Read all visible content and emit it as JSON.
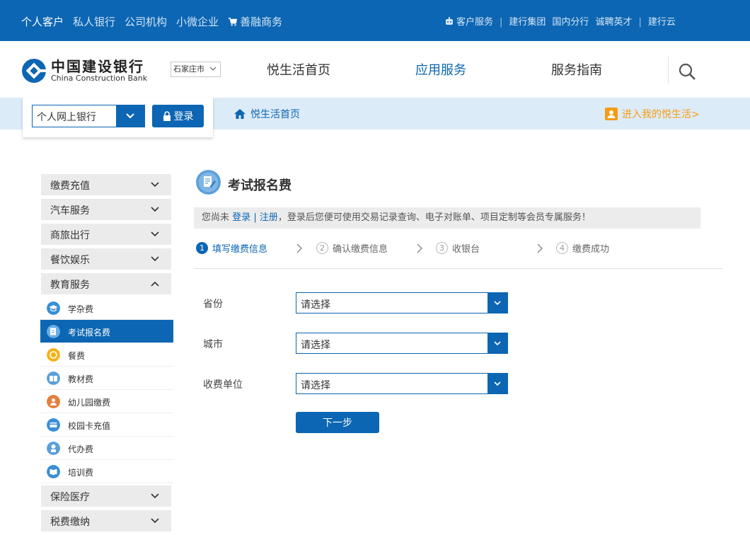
{
  "colors": {
    "brand": "#0c66b3",
    "accent_orange": "#f39c12",
    "subbar": "#dcebf8"
  },
  "topnav": {
    "items": [
      {
        "label": "个人客户",
        "active": true
      },
      {
        "label": "私人银行"
      },
      {
        "label": "公司机构"
      },
      {
        "label": "小微企业"
      },
      {
        "label": "善融商务",
        "icon": "cart-icon"
      }
    ],
    "right": {
      "customer_service": "客户服务",
      "group": "建行集团",
      "domestic": "国内分行",
      "careers": "诚聘英才",
      "cloud": "建行云"
    }
  },
  "header": {
    "logo_cn": "中国建设银行",
    "logo_en": "China Construction Bank",
    "city": "石家庄市",
    "nav": [
      {
        "label": "悦生活首页"
      },
      {
        "label": "应用服务",
        "active": true
      },
      {
        "label": "服务指南"
      }
    ],
    "search_icon": "search-icon"
  },
  "login": {
    "bank_type": "个人网上银行",
    "login_label": "登录"
  },
  "breadcrumb": {
    "home_label": "悦生活首页"
  },
  "mylife_link": "进入我的悦生活>",
  "sidebar": {
    "categories_top": [
      {
        "label": "缴费充值"
      },
      {
        "label": "汽车服务"
      },
      {
        "label": "商旅出行"
      },
      {
        "label": "餐饮娱乐"
      }
    ],
    "expanded": {
      "label": "教育服务",
      "items": [
        {
          "label": "学杂费",
          "icon": "graduation-cap-icon",
          "color": "#3a8fd6"
        },
        {
          "label": "考试报名费",
          "icon": "exam-icon",
          "color": "#6aaee6",
          "active": true
        },
        {
          "label": "餐费",
          "icon": "meal-icon",
          "color": "#f2b21c"
        },
        {
          "label": "教材费",
          "icon": "book-icon",
          "color": "#5b9fd8"
        },
        {
          "label": "幼儿园缴费",
          "icon": "kindergarten-icon",
          "color": "#e67e3c"
        },
        {
          "label": "校园卡充值",
          "icon": "campus-card-icon",
          "color": "#3a8fd6"
        },
        {
          "label": "代办费",
          "icon": "agent-icon",
          "color": "#5b9fd8"
        },
        {
          "label": "培训费",
          "icon": "training-icon",
          "color": "#3a8fd6"
        }
      ]
    },
    "categories_bottom": [
      {
        "label": "保险医疗"
      },
      {
        "label": "税费缴纳"
      }
    ]
  },
  "main": {
    "title": "考试报名费",
    "notice": {
      "prefix": "您尚未",
      "login": "登录",
      "sep": "|",
      "register": "注册",
      "suffix": "，登录后您便可使用交易记录查询、电子对账单、项目定制等会员专属服务！"
    },
    "steps": [
      {
        "num": "1",
        "label": "填写缴费信息",
        "active": true
      },
      {
        "num": "2",
        "label": "确认缴费信息"
      },
      {
        "num": "3",
        "label": "收银台"
      },
      {
        "num": "4",
        "label": "缴费成功"
      }
    ],
    "fields": [
      {
        "label": "省份",
        "value": "请选择"
      },
      {
        "label": "城市",
        "value": "请选择"
      },
      {
        "label": "收费单位",
        "value": "请选择"
      }
    ],
    "next_label": "下一步"
  }
}
